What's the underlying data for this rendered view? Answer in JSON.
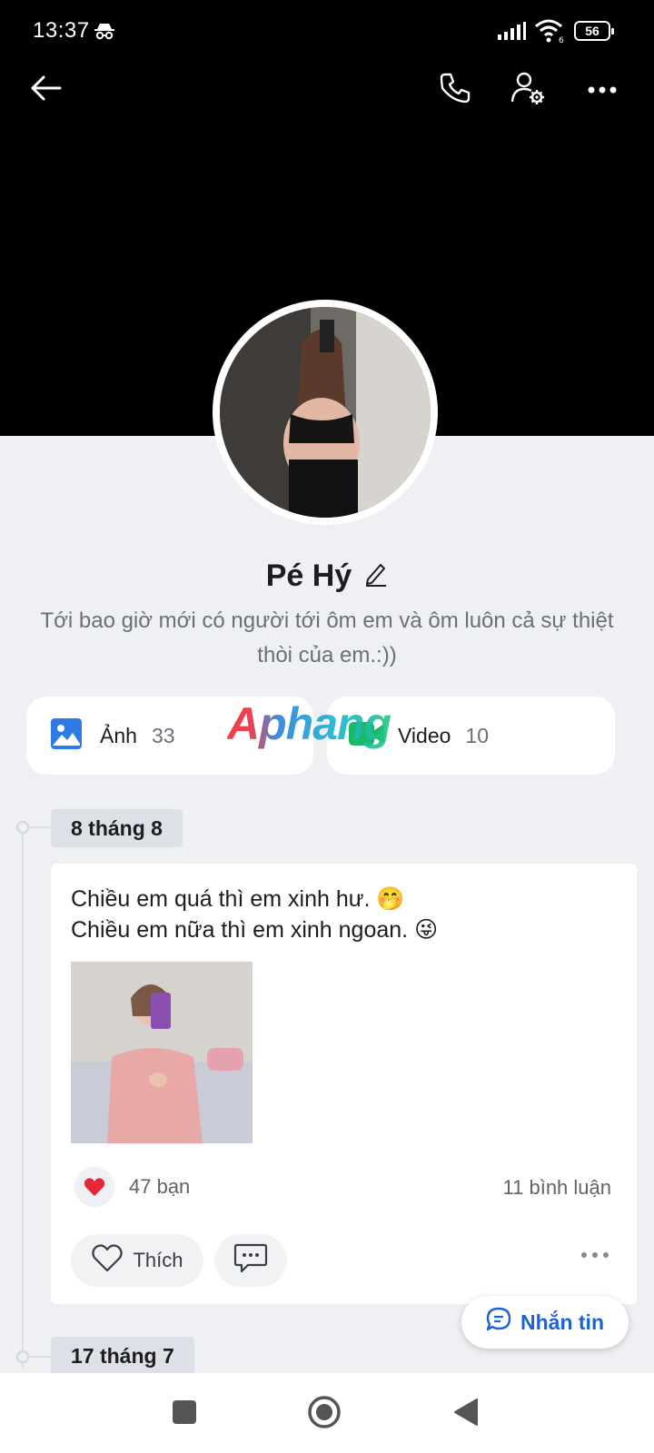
{
  "status_bar": {
    "time": "13:37",
    "battery": "56"
  },
  "profile": {
    "name": "Pé Hý",
    "bio": "Tới bao giờ mới có người tới ôm em và ôm luôn cả sự thiệt thòi của em.:))"
  },
  "media": {
    "photos": {
      "label": "Ảnh",
      "count": "33"
    },
    "videos": {
      "label": "Video",
      "count": "10"
    }
  },
  "watermark": "Aphang",
  "timeline": [
    {
      "date": "8 tháng 8",
      "text_line1": "Chiều em quá thì em xinh hư. 🤭",
      "text_line2": "Chiều em nữa thì em xinh ngoan. 😜",
      "reactions": "47 bạn",
      "comments": "11 bình luận",
      "like_label": "Thích"
    },
    {
      "date": "17 tháng 7"
    }
  ],
  "message_button": "Nhắn tin",
  "colors": {
    "accent": "#1a63d6",
    "cover": "#000000",
    "background": "#eef0f3",
    "heart": "#e8263a"
  }
}
